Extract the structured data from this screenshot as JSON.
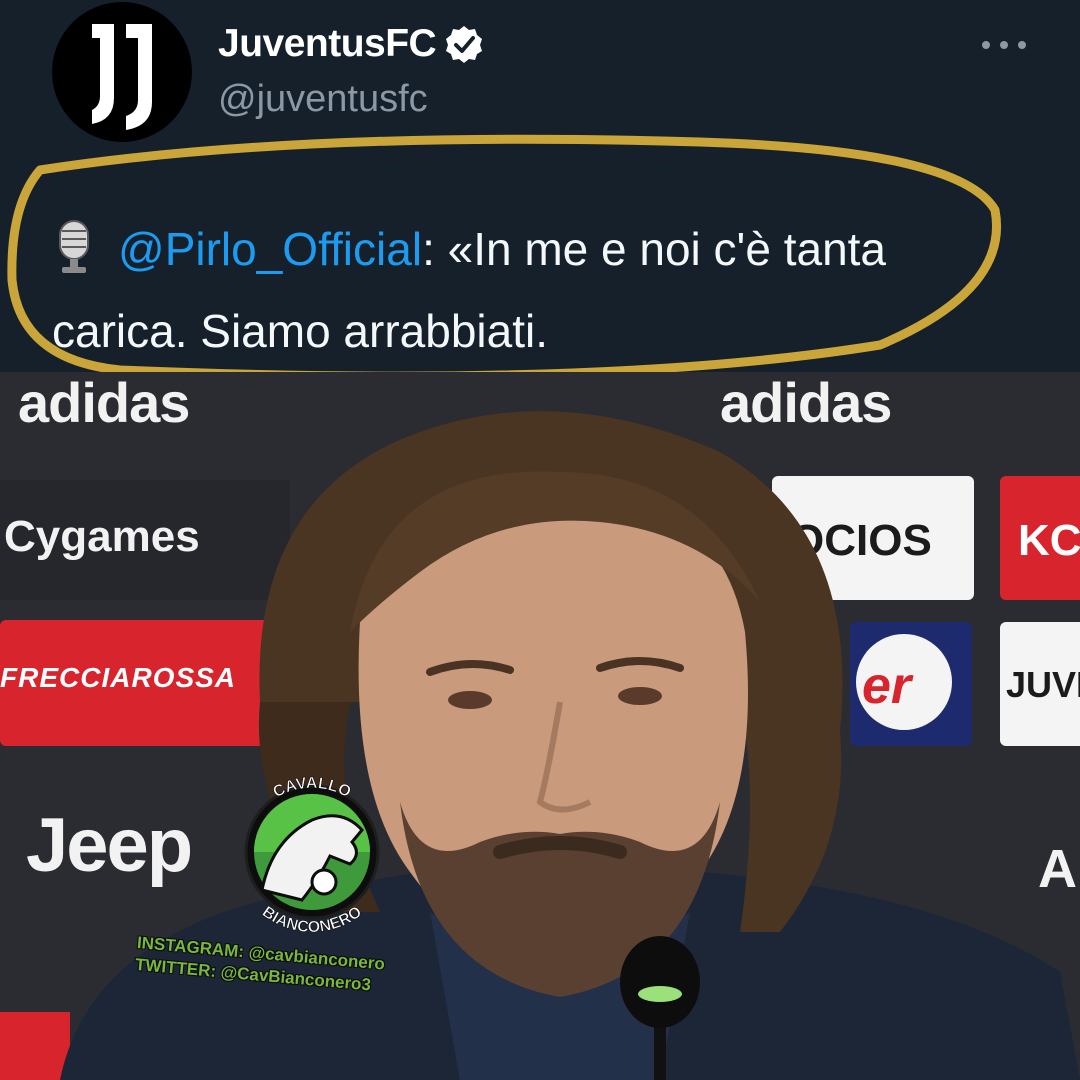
{
  "tweet": {
    "display_name": "JuventusFC",
    "handle": "@juventusfc",
    "mention": "@Pirlo_Official",
    "text": ": «In me e noi c'è tanta carica. Siamo arrabbiati.",
    "icons": {
      "avatar": "juventus-logo-icon",
      "verified": "verified-badge-icon",
      "more": "more-options-icon",
      "microphone": "microphone-icon"
    },
    "colors": {
      "background": "#15202b",
      "mention": "#1d9bf0",
      "highlight": "#c9a53a"
    }
  },
  "photo": {
    "sponsors": {
      "adidas_left": "adidas",
      "adidas_right": "adidas",
      "cygames": "Cygames",
      "frecciarossa": "FRECCIAROSSA",
      "jeep": "Jeep",
      "socios": "OCIOS",
      "ko": "KC",
      "er": "er",
      "juve": "JUVI",
      "ad": "AD"
    }
  },
  "watermark": {
    "arc_top": "CAVALLO",
    "arc_bottom": "BIANCONERO",
    "instagram": "INSTAGRAM: @cavbianconero",
    "twitter": "TWITTER: @CavBianconero3"
  }
}
